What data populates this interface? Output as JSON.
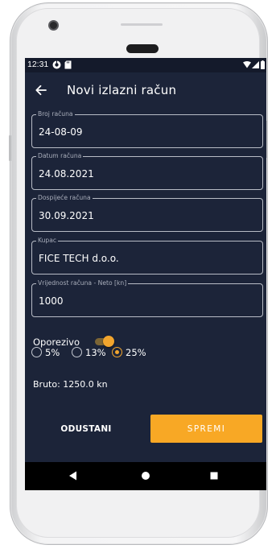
{
  "status_bar": {
    "time": "12:31"
  },
  "app_bar": {
    "title": "Novi izlazni račun"
  },
  "fields": [
    {
      "label": "Broj računa",
      "value": "24-08-09"
    },
    {
      "label": "Datum računa",
      "value": "24.08.2021"
    },
    {
      "label": "Dospijeće računa",
      "value": "30.09.2021"
    },
    {
      "label": "Kupac",
      "value": "FICE TECH d.o.o."
    },
    {
      "label": "Vrijednost računa - Neto [kn]",
      "value": "1000"
    }
  ],
  "tax_toggle": {
    "label": "Oporezivo",
    "on": true
  },
  "vat_rates": {
    "options": [
      "5%",
      "13%",
      "25%"
    ],
    "selected": "25%"
  },
  "gross": {
    "text": "Bruto: 1250.0 kn"
  },
  "buttons": {
    "cancel": "ODUSTANI",
    "save": "SPREMI"
  },
  "colors": {
    "screen_background": "#1c2439",
    "status_bar": "#141a2b",
    "accent": "#f8a825",
    "field_border": "#b8bcc6",
    "nav_bar": "#000000"
  }
}
